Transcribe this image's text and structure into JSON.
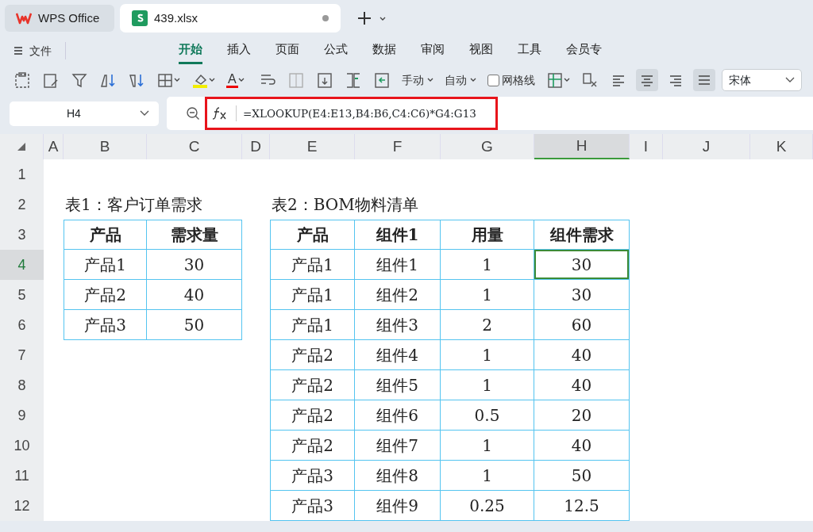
{
  "window": {
    "tabs": [
      {
        "label": "WPS Office",
        "kind": "home",
        "selected": false,
        "unsaved": false
      },
      {
        "label": "439.xlsx",
        "kind": "sheet",
        "selected": true,
        "unsaved": true
      }
    ]
  },
  "menu": {
    "file": "文件",
    "tabs": [
      {
        "label": "开始",
        "selected": true
      },
      {
        "label": "插入",
        "selected": false
      },
      {
        "label": "页面",
        "selected": false
      },
      {
        "label": "公式",
        "selected": false
      },
      {
        "label": "数据",
        "selected": false
      },
      {
        "label": "审阅",
        "selected": false
      },
      {
        "label": "视图",
        "selected": false
      },
      {
        "label": "工具",
        "selected": false
      },
      {
        "label": "会员专",
        "selected": false
      }
    ]
  },
  "toolbar": {
    "font_color": "A",
    "row_height": "手动",
    "column_width": "自动",
    "gridlines": {
      "label": "网格线",
      "checked": false
    },
    "align": [
      {
        "selected": false
      },
      {
        "selected": true
      },
      {
        "selected": false
      },
      {
        "selected": true
      }
    ],
    "font": "宋体"
  },
  "formula_bar": {
    "name_box": "H4",
    "formula": "=XLOOKUP(E4:E13,B4:B6,C4:C6)*G4:G13",
    "highlighted": true
  },
  "sheet": {
    "tables": [
      {
        "title": "表1：客户订单需求",
        "headers": [
          "产品",
          "需求量"
        ],
        "rows": [
          {
            "cells": [
              {
                "text": "产品1",
                "selected": false
              },
              {
                "text": "30",
                "selected": false
              }
            ]
          },
          {
            "cells": [
              {
                "text": "产品2",
                "selected": false
              },
              {
                "text": "40",
                "selected": false
              }
            ]
          },
          {
            "cells": [
              {
                "text": "产品3",
                "selected": false
              },
              {
                "text": "50",
                "selected": false
              }
            ]
          }
        ]
      },
      {
        "title": "表2：BOM物料清单",
        "headers": [
          "产品",
          "组件1",
          "用量",
          "组件需求"
        ],
        "rows": [
          {
            "cells": [
              {
                "text": "产品1",
                "selected": false
              },
              {
                "text": "组件1",
                "selected": false
              },
              {
                "text": "1",
                "selected": false
              },
              {
                "text": "30",
                "selected": true
              }
            ]
          },
          {
            "cells": [
              {
                "text": "产品1",
                "selected": false
              },
              {
                "text": "组件2",
                "selected": false
              },
              {
                "text": "1",
                "selected": false
              },
              {
                "text": "30",
                "selected": false
              }
            ]
          },
          {
            "cells": [
              {
                "text": "产品1",
                "selected": false
              },
              {
                "text": "组件3",
                "selected": false
              },
              {
                "text": "2",
                "selected": false
              },
              {
                "text": "60",
                "selected": false
              }
            ]
          },
          {
            "cells": [
              {
                "text": "产品2",
                "selected": false
              },
              {
                "text": "组件4",
                "selected": false
              },
              {
                "text": "1",
                "selected": false
              },
              {
                "text": "40",
                "selected": false
              }
            ]
          },
          {
            "cells": [
              {
                "text": "产品2",
                "selected": false
              },
              {
                "text": "组件5",
                "selected": false
              },
              {
                "text": "1",
                "selected": false
              },
              {
                "text": "40",
                "selected": false
              }
            ]
          },
          {
            "cells": [
              {
                "text": "产品2",
                "selected": false
              },
              {
                "text": "组件6",
                "selected": false
              },
              {
                "text": "0.5",
                "selected": false
              },
              {
                "text": "20",
                "selected": false
              }
            ]
          },
          {
            "cells": [
              {
                "text": "产品2",
                "selected": false
              },
              {
                "text": "组件7",
                "selected": false
              },
              {
                "text": "1",
                "selected": false
              },
              {
                "text": "40",
                "selected": false
              }
            ]
          },
          {
            "cells": [
              {
                "text": "产品3",
                "selected": false
              },
              {
                "text": "组件8",
                "selected": false
              },
              {
                "text": "1",
                "selected": false
              },
              {
                "text": "50",
                "selected": false
              }
            ]
          },
          {
            "cells": [
              {
                "text": "产品3",
                "selected": false
              },
              {
                "text": "组件9",
                "selected": false
              },
              {
                "text": "0.25",
                "selected": false
              },
              {
                "text": "12.5",
                "selected": false
              }
            ]
          }
        ]
      }
    ],
    "columns": [
      {
        "label": "A",
        "selected": false
      },
      {
        "label": "B",
        "selected": false
      },
      {
        "label": "C",
        "selected": false
      },
      {
        "label": "D",
        "selected": false
      },
      {
        "label": "E",
        "selected": false
      },
      {
        "label": "F",
        "selected": false
      },
      {
        "label": "G",
        "selected": false
      },
      {
        "label": "H",
        "selected": true
      },
      {
        "label": "I",
        "selected": false
      },
      {
        "label": "J",
        "selected": false
      },
      {
        "label": "K",
        "selected": false
      }
    ],
    "rows": [
      {
        "label": "1",
        "selected": false
      },
      {
        "label": "2",
        "selected": false
      },
      {
        "label": "3",
        "selected": false
      },
      {
        "label": "4",
        "selected": true
      },
      {
        "label": "5",
        "selected": false
      },
      {
        "label": "6",
        "selected": false
      },
      {
        "label": "7",
        "selected": false
      },
      {
        "label": "8",
        "selected": false
      },
      {
        "label": "9",
        "selected": false
      },
      {
        "label": "10",
        "selected": false
      },
      {
        "label": "11",
        "selected": false
      },
      {
        "label": "12",
        "selected": false
      }
    ]
  }
}
